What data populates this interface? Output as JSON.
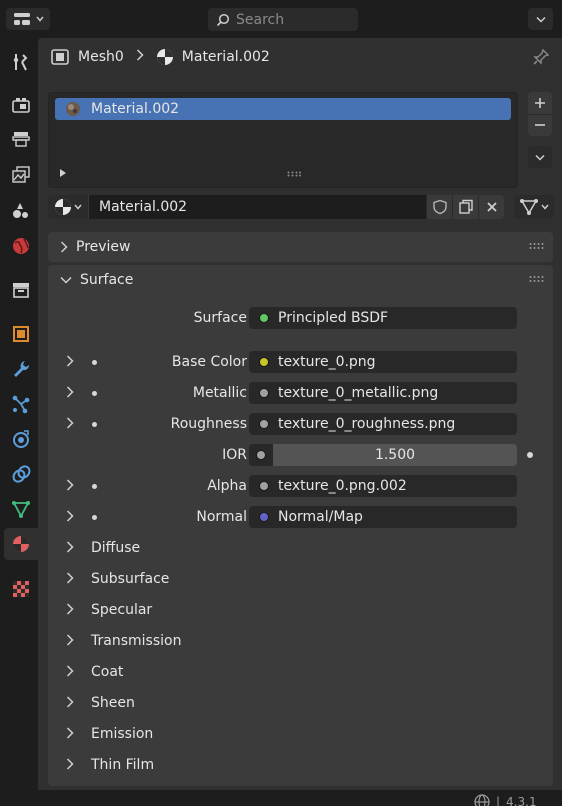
{
  "header": {
    "search_placeholder": "Search"
  },
  "breadcrumb": {
    "object": "Mesh0",
    "separator": ">",
    "material": "Material.002"
  },
  "material_slots": {
    "items": [
      "Material.002"
    ],
    "add": "+",
    "remove": "−"
  },
  "material_selector": {
    "name": "Material.002"
  },
  "panels": {
    "preview": "Preview",
    "surface": "Surface"
  },
  "surface": {
    "shader_label": "Surface",
    "shader_value": "Principled BSDF",
    "inputs": [
      {
        "label": "Base Color",
        "value": "texture_0.png",
        "socket_color": "#c7c729"
      },
      {
        "label": "Metallic",
        "value": "texture_0_metallic.png",
        "socket_color": "#a1a1a1"
      },
      {
        "label": "Roughness",
        "value": "texture_0_roughness.png",
        "socket_color": "#a1a1a1"
      },
      {
        "label": "IOR",
        "value": "1.500",
        "socket_color": "#a1a1a1"
      },
      {
        "label": "Alpha",
        "value": "texture_0.png.002",
        "socket_color": "#a1a1a1"
      },
      {
        "label": "Normal",
        "value": "Normal/Map",
        "socket_color": "#6363c7"
      }
    ],
    "subpanels": [
      "Diffuse",
      "Subsurface",
      "Specular",
      "Transmission",
      "Coat",
      "Sheen",
      "Emission",
      "Thin Film"
    ]
  },
  "status": {
    "version": "4.3.1"
  },
  "colors": {
    "accent": "#4772b3",
    "shader_socket": "#63c763"
  },
  "tabs": [
    {
      "icon": "tool-icon"
    },
    {
      "icon": "render-icon"
    },
    {
      "icon": "output-icon"
    },
    {
      "icon": "view-layer-icon"
    },
    {
      "icon": "scene-icon"
    },
    {
      "icon": "world-icon"
    },
    {
      "icon": "collection-icon"
    },
    {
      "icon": "object-icon"
    },
    {
      "icon": "modifier-icon"
    },
    {
      "icon": "particles-icon"
    },
    {
      "icon": "physics-icon"
    },
    {
      "icon": "constraints-icon"
    },
    {
      "icon": "data-icon"
    },
    {
      "icon": "material-icon"
    },
    {
      "icon": "texture-icon"
    }
  ]
}
